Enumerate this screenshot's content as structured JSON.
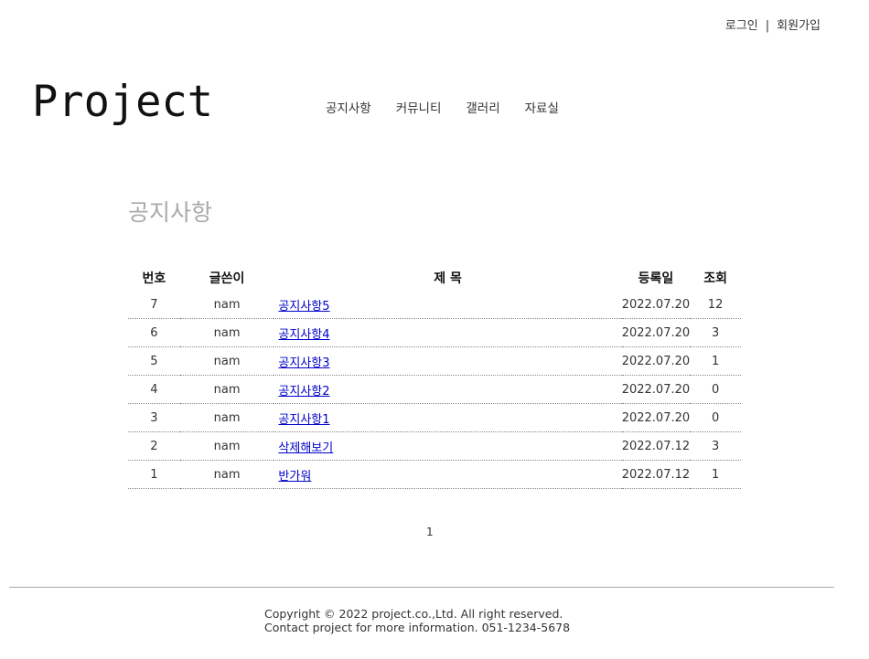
{
  "topmenu": {
    "login": "로그인",
    "separator": "|",
    "signup": "회원가입"
  },
  "logo": "Project",
  "nav": [
    "공지사항",
    "커뮤니티",
    "갤러리",
    "자료실"
  ],
  "page_title": "공지사항",
  "board": {
    "headers": [
      "번호",
      "글쓴이",
      "제 목",
      "등록일",
      "조회"
    ],
    "rows": [
      {
        "no": "7",
        "author": "nam",
        "title": "공지사항5",
        "date": "2022.07.20",
        "views": "12"
      },
      {
        "no": "6",
        "author": "nam",
        "title": "공지사항4",
        "date": "2022.07.20",
        "views": "3"
      },
      {
        "no": "5",
        "author": "nam",
        "title": "공지사항3",
        "date": "2022.07.20",
        "views": "1"
      },
      {
        "no": "4",
        "author": "nam",
        "title": "공지사항2",
        "date": "2022.07.20",
        "views": "0"
      },
      {
        "no": "3",
        "author": "nam",
        "title": "공지사항1",
        "date": "2022.07.20",
        "views": "0"
      },
      {
        "no": "2",
        "author": "nam",
        "title": "삭제해보기",
        "date": "2022.07.12",
        "views": "3"
      },
      {
        "no": "1",
        "author": "nam",
        "title": "반가워",
        "date": "2022.07.12",
        "views": "1"
      }
    ]
  },
  "pager": {
    "current": "1"
  },
  "footer": {
    "copyright": "Copyright © 2022 project.co.,Ltd. All right reserved.",
    "contact": "Contact project for more information. 051-1234-5678"
  }
}
